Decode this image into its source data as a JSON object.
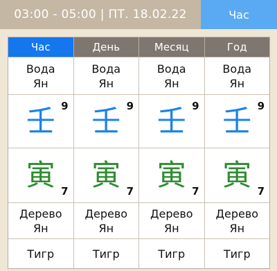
{
  "header": {
    "title": "03:00 - 05:00 | ПТ. 18.02.22",
    "button_label": "Час"
  },
  "tabs": [
    "Час",
    "День",
    "Месяц",
    "Год"
  ],
  "columns": [
    {
      "element": "Вода",
      "polarity": "Ян",
      "stem": "壬",
      "stem_number": "9",
      "branch": "寅",
      "branch_number": "7",
      "branch_element": "Дерево",
      "branch_polarity": "Ян",
      "animal": "Тигр"
    },
    {
      "element": "Вода",
      "polarity": "Ян",
      "stem": "壬",
      "stem_number": "9",
      "branch": "寅",
      "branch_number": "7",
      "branch_element": "Дерево",
      "branch_polarity": "Ян",
      "animal": "Тигр"
    },
    {
      "element": "Вода",
      "polarity": "Ян",
      "stem": "壬",
      "stem_number": "9",
      "branch": "寅",
      "branch_number": "7",
      "branch_element": "Дерево",
      "branch_polarity": "Ян",
      "animal": "Тигр"
    },
    {
      "element": "Вода",
      "polarity": "Ян",
      "stem": "壬",
      "stem_number": "9",
      "branch": "寅",
      "branch_number": "7",
      "branch_element": "Дерево",
      "branch_polarity": "Ян",
      "animal": "Тигр"
    }
  ],
  "colors": {
    "background": "#efe6d6",
    "topbar": "#c4b8a4",
    "accent": "#5aaaf3",
    "active_tab": "#1477ee",
    "inactive_tab": "#7f776f",
    "stem_color": "#1c83e6",
    "branch_color": "#2f8c30"
  }
}
